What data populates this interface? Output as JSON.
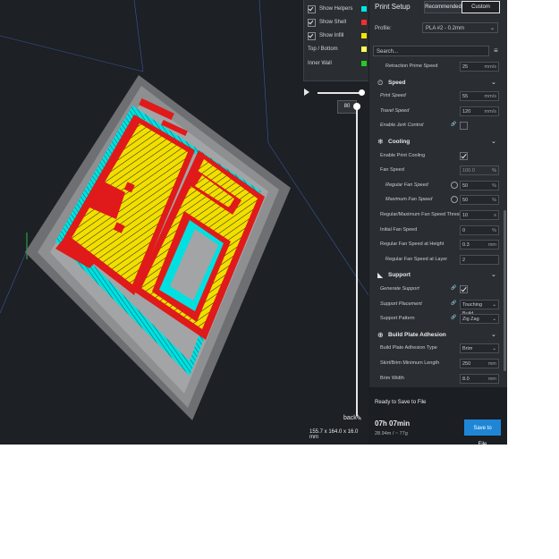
{
  "legend": {
    "items": [
      {
        "label": "Show Helpers",
        "checked": true,
        "color": "#00e5e5"
      },
      {
        "label": "Show Shell",
        "checked": true,
        "color": "#ff2a2a"
      },
      {
        "label": "Show Infill",
        "checked": true,
        "color": "#f5e600"
      },
      {
        "label": "Top / Bottom",
        "checked": false,
        "color": "#ffff55"
      },
      {
        "label": "Inner Wall",
        "checked": false,
        "color": "#22cc22"
      }
    ]
  },
  "layer": {
    "current": "80"
  },
  "object": {
    "name": "back",
    "dimensions": "155.7 x 164.0 x 16.0 mm"
  },
  "panel": {
    "title": "Print Setup",
    "recommended_label": "Recommended",
    "custom_label": "Custom",
    "profile_label": "Profile:",
    "profile_value": "PLA #2 - 0.2mm",
    "search_placeholder": "Search...",
    "rows": [
      {
        "kind": "setting",
        "label": "Retraction Prime Speed",
        "value": "25",
        "unit": "mm/s",
        "indent": 1
      },
      {
        "kind": "category",
        "label": "Speed",
        "icon": "⏲"
      },
      {
        "kind": "setting",
        "label": "Print Speed",
        "value": "55",
        "unit": "mm/s",
        "indent": 0,
        "italic": true
      },
      {
        "kind": "setting",
        "label": "Travel Speed",
        "value": "120",
        "unit": "mm/s",
        "indent": 0,
        "italic": true
      },
      {
        "kind": "check",
        "label": "Enable Jerk Control",
        "checked": false,
        "indent": 0,
        "italic": true,
        "link": true
      },
      {
        "kind": "category",
        "label": "Cooling",
        "icon": "❄"
      },
      {
        "kind": "check",
        "label": "Enable Print Cooling",
        "checked": true,
        "indent": 0
      },
      {
        "kind": "setting",
        "label": "Fan Speed",
        "value": "100.0",
        "unit": "%",
        "indent": 0,
        "disabled": true
      },
      {
        "kind": "setting",
        "label": "Regular Fan Speed",
        "value": "50",
        "unit": "%",
        "indent": 1,
        "italic": true,
        "reset": true
      },
      {
        "kind": "setting",
        "label": "Maximum Fan Speed",
        "value": "50",
        "unit": "%",
        "indent": 1,
        "italic": true,
        "reset": true
      },
      {
        "kind": "setting",
        "label": "Regular/Maximum Fan Speed Threshold",
        "value": "10",
        "unit": "s",
        "indent": 0
      },
      {
        "kind": "setting",
        "label": "Initial Fan Speed",
        "value": "0",
        "unit": "%",
        "indent": 0
      },
      {
        "kind": "setting",
        "label": "Regular Fan Speed at Height",
        "value": "0.3",
        "unit": "mm",
        "indent": 0
      },
      {
        "kind": "setting",
        "label": "Regular Fan Speed at Layer",
        "value": "2",
        "unit": "",
        "indent": 1
      },
      {
        "kind": "category",
        "label": "Support",
        "icon": "◣"
      },
      {
        "kind": "check",
        "label": "Generate Support",
        "checked": true,
        "indent": 0,
        "italic": true,
        "link": true
      },
      {
        "kind": "dropdown",
        "label": "Support Placement",
        "value": "Touching Buildplate",
        "display": "Touching Build...",
        "indent": 0,
        "italic": true,
        "link": true
      },
      {
        "kind": "dropdown",
        "label": "Support Pattern",
        "value": "Zig Zag",
        "display": "Zig Zag",
        "indent": 0,
        "link": true
      },
      {
        "kind": "category",
        "label": "Build Plate Adhesion",
        "icon": "⊕"
      },
      {
        "kind": "dropdown",
        "label": "Build Plate Adhesion Type",
        "value": "Brim",
        "display": "Brim",
        "indent": 0
      },
      {
        "kind": "setting",
        "label": "Skirt/Brim Minimum Length",
        "value": "250",
        "unit": "mm",
        "indent": 0
      },
      {
        "kind": "setting",
        "label": "Brim Width",
        "value": "8.0",
        "unit": "mm",
        "indent": 0
      }
    ]
  },
  "footer": {
    "ready_label": "Ready to Save to File",
    "time": "07h 07min",
    "material": "28.94m / ~ 77g",
    "save_label": "Save to File"
  }
}
